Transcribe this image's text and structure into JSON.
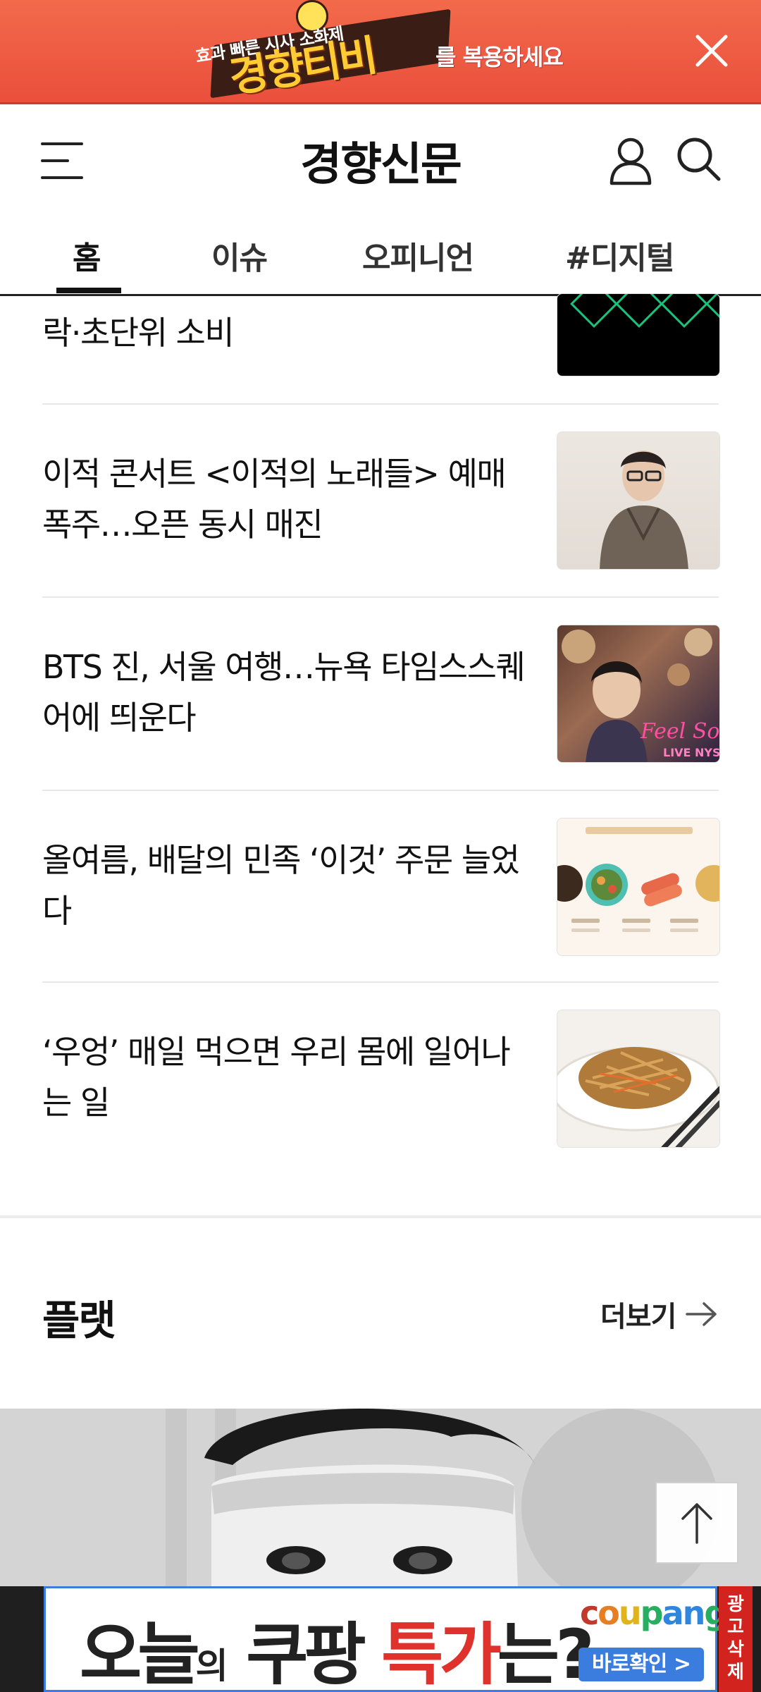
{
  "promo": {
    "subtitle": "효과 빠른 시사 소화제",
    "brand": "경향티비",
    "tagline": "를 복용하세요"
  },
  "header": {
    "logo": "경향신문"
  },
  "tabs": [
    {
      "label": "홈",
      "active": true
    },
    {
      "label": "이슈",
      "active": false
    },
    {
      "label": "오피니언",
      "active": false
    },
    {
      "label": "#디지털",
      "active": false
    }
  ],
  "articles": [
    {
      "title": "락·초단위 소비",
      "image": "dark-graphic"
    },
    {
      "title": "이적 콘서트 <이적의 노래들> 예매 폭주…오픈 동시 매진",
      "image": "singer-portrait"
    },
    {
      "title": "BTS 진, 서울 여행…뉴욕 타임스스퀘어에 띄운다",
      "image": "bts-jin-billboard"
    },
    {
      "title": "올여름, 배달의 민족 ‘이것’ 주문 늘었다",
      "image": "delivery-food-menu"
    },
    {
      "title": "‘우엉’ 매일 먹으면 우리 몸에 일어나는 일",
      "image": "burdock-dish"
    }
  ],
  "section": {
    "title": "플랫",
    "more_label": "더보기"
  },
  "bottom_ad": {
    "text_part1": "오늘",
    "text_part2": "의",
    "text_part3": "쿠팡",
    "text_part4": "특가",
    "text_part5": "는?",
    "brand": "coupang",
    "cta": "바로확인 >",
    "remove_label": "광고삭제",
    "brand_colors": [
      "#c0392b",
      "#e67e22",
      "#f1c40f",
      "#27ae60",
      "#2e86de"
    ]
  },
  "colors": {
    "promo_bg": "#ea4f3c",
    "ad_accent": "#3b7dde",
    "ad_remove": "#d2231f"
  }
}
